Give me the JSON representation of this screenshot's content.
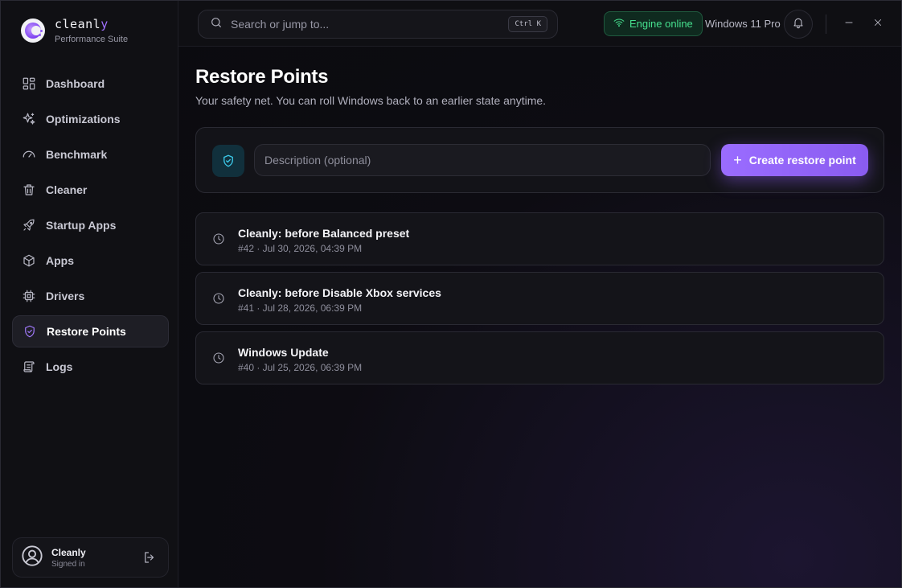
{
  "brand": {
    "name_prefix": "cleanl",
    "name_accent": "y",
    "subtitle": "Performance Suite"
  },
  "sidebar": {
    "items": [
      {
        "label": "Dashboard",
        "icon": "dashboard-icon"
      },
      {
        "label": "Optimizations",
        "icon": "sparkles-icon"
      },
      {
        "label": "Benchmark",
        "icon": "gauge-icon"
      },
      {
        "label": "Cleaner",
        "icon": "trash-icon"
      },
      {
        "label": "Startup Apps",
        "icon": "rocket-icon"
      },
      {
        "label": "Apps",
        "icon": "box-icon"
      },
      {
        "label": "Drivers",
        "icon": "chip-icon"
      },
      {
        "label": "Restore Points",
        "icon": "shield-check-icon",
        "active": true
      },
      {
        "label": "Logs",
        "icon": "scroll-icon"
      }
    ]
  },
  "user": {
    "name": "Cleanly",
    "status": "Signed in"
  },
  "topbar": {
    "search_placeholder": "Search or jump to...",
    "shortcut": "Ctrl K",
    "engine_status": "Engine online",
    "os": "Windows 11 Pro"
  },
  "page": {
    "title": "Restore Points",
    "subtitle": "Your safety net. You can roll Windows back to an earlier state anytime."
  },
  "create": {
    "description_placeholder": "Description (optional)",
    "button_label": "Create restore point"
  },
  "restore_points": [
    {
      "name": "Cleanly: before Balanced preset",
      "meta": "#42 · Jul 30, 2026, 04:39 PM"
    },
    {
      "name": "Cleanly: before Disable Xbox services",
      "meta": "#41 · Jul 28, 2026, 06:39 PM"
    },
    {
      "name": "Windows Update",
      "meta": "#40 · Jul 25, 2026, 06:39 PM"
    }
  ],
  "colors": {
    "accent": "#9a6cff",
    "engine_online": "#46e08e",
    "shield": "#3cc8e8"
  }
}
